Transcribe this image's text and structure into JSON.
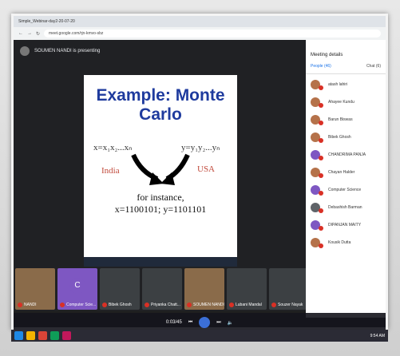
{
  "window": {
    "title": "Simple_Webinar-day2-20-07-20"
  },
  "browser": {
    "url": "meet.google.com/rjn-kmvo-sbz"
  },
  "meeting": {
    "presenter_text": "SOUMEN NANDI is presenting",
    "slide": {
      "title": "Example: Monte Carlo",
      "x_seq": "x=x₁x₂...xₙ",
      "y_seq": "y=y₁y₂...yₙ",
      "left_label": "India",
      "right_label": "USA",
      "instance_line1": "for instance,",
      "instance_line2": "x=1100101; y=1101101"
    },
    "tiles": [
      {
        "name": "NANDI",
        "letter": "",
        "color": "#8a6b4a"
      },
      {
        "name": "Computer Scie...",
        "letter": "C",
        "color": "#7e57c2"
      },
      {
        "name": "Bibek Ghosh",
        "letter": "",
        "color": "#3c4043"
      },
      {
        "name": "Priyanka Chatt...",
        "letter": "",
        "color": "#3c4043"
      },
      {
        "name": "SOUMEN NANDI",
        "letter": "",
        "color": "#8a6b4a"
      },
      {
        "name": "Lubani Mandal",
        "letter": "",
        "color": "#3c4043"
      },
      {
        "name": "Souzer Nayak",
        "letter": "",
        "color": "#3c4043"
      }
    ]
  },
  "sidebar": {
    "title": "Meeting details",
    "tab_people": "People (46)",
    "tab_chat": "Chat (6)",
    "people": [
      {
        "name": "atash lahiri",
        "color": "#b5724a"
      },
      {
        "name": "Ahayee Kundu",
        "color": "#b5724a"
      },
      {
        "name": "Barun Biswas",
        "color": "#b5724a"
      },
      {
        "name": "Bibek Ghosh",
        "color": "#b5724a"
      },
      {
        "name": "CHANDRIMA PANJA",
        "color": "#7e57c2"
      },
      {
        "name": "Chayan Halder",
        "color": "#b5724a"
      },
      {
        "name": "Computer Science",
        "color": "#7e57c2"
      },
      {
        "name": "Debashish Barman",
        "color": "#5f6368"
      },
      {
        "name": "DIPANJAN MAITY",
        "color": "#7e57c2"
      },
      {
        "name": "Kousik Dutta",
        "color": "#b5724a"
      }
    ]
  },
  "player": {
    "time": "0:03/45"
  },
  "clock": "9:54 AM"
}
